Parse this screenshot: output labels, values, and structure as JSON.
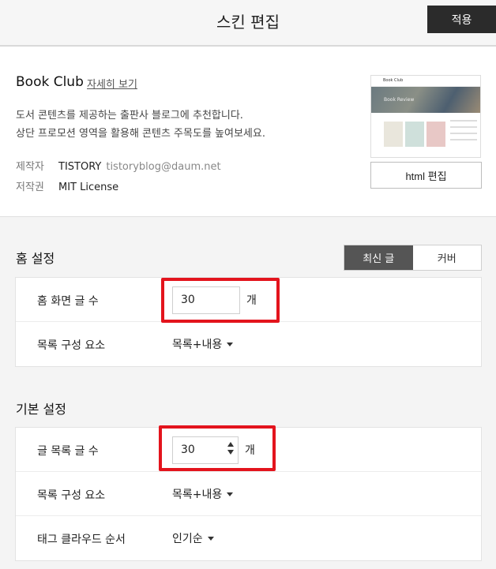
{
  "header": {
    "title": "스킨 편집",
    "apply_label": "적용"
  },
  "skin": {
    "name": "Book Club",
    "detail_link": "자세히 보기",
    "description_line1": "도서 콘텐츠를 제공하는 출판사 블로그에 추천합니다.",
    "description_line2": "상단 프로모션 영역을 활용해 콘텐츠 주목도를 높여보세요.",
    "author_label": "제작자",
    "author_name": "TISTORY",
    "author_email": "tistoryblog@daum.net",
    "license_label": "저작권",
    "license_value": "MIT License",
    "thumbnail": {
      "logo_text": "Book Club",
      "hero_text": "Book Review"
    },
    "html_edit_label": "html 편집"
  },
  "home_settings": {
    "title": "홈 설정",
    "toggle": {
      "options": [
        "최신 글",
        "커버"
      ],
      "selected": "최신 글"
    },
    "rows": [
      {
        "label": "홈 화면 글 수",
        "value": "30",
        "unit": "개"
      },
      {
        "label": "목록 구성 요소",
        "value": "목록+내용"
      }
    ]
  },
  "basic_settings": {
    "title": "기본 설정",
    "rows": [
      {
        "label": "글 목록 글 수",
        "value": "30",
        "unit": "개"
      },
      {
        "label": "목록 구성 요소",
        "value": "목록+내용"
      },
      {
        "label": "태그 클라우드 순서",
        "value": "인기순"
      }
    ]
  },
  "colors": {
    "highlight": "#e3141d",
    "apply_bg": "#2b2b2b",
    "toggle_active": "#555555"
  }
}
